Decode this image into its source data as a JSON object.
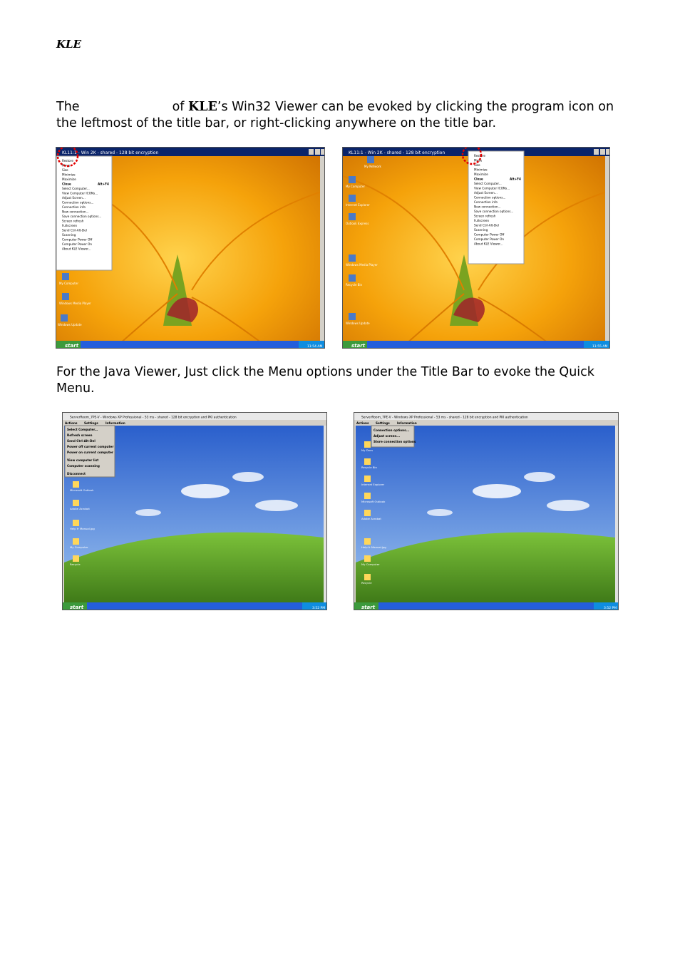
{
  "header": {
    "brand": "KLE"
  },
  "intro": {
    "part1": "The",
    "part2": "of",
    "brand": "KLE",
    "part3": "’s Win32 Viewer can be evoked by clicking the program icon on the leftmost of the title bar, or right-clicking anywhere on the title bar."
  },
  "java_note": "For the Java Viewer, Just click the Menu options under the Title Bar to evoke the Quick Menu.",
  "win32_left": {
    "title": "KL11:1 - Win 2K - shared - 128 bit encryption",
    "menu_items": [
      "Restore",
      "Move",
      "Size",
      "Minimize",
      "Maximize",
      "Close",
      "Alt+F4",
      "Select Computer...",
      "View Computer ICONs...",
      "Adjust Screen...",
      "Connection options...",
      "Connection info",
      "New connection...",
      "Save connection options...",
      "Screen refresh",
      "Fullscreen",
      "Send Ctrl-Alt-Del",
      "Scanning",
      "Computer Power Off",
      "Computer Power On",
      "About KLE Viewer..."
    ],
    "taskbar": {
      "start": "start",
      "clock": "11:54 AM"
    },
    "desktop_icons": [
      "My Computer",
      "Windows Media Player",
      "Windows Update"
    ]
  },
  "win32_right": {
    "title": "KL11:1 - Win 2K - shared - 128 bit encryption",
    "menu_items": [
      "Restore",
      "Move",
      "Size",
      "Minimize",
      "Maximize",
      "Close",
      "Alt+F4",
      "Select Computer...",
      "View Computer ICONs...",
      "Adjust Screen...",
      "Connection options...",
      "Connection info",
      "New connection...",
      "Save connection options...",
      "Screen refresh",
      "Fullscreen",
      "Send Ctrl-Alt-Del",
      "Scanning",
      "Computer Power Off",
      "Computer Power On",
      "About KLE Viewer..."
    ],
    "taskbar": {
      "start": "start",
      "clock": "11:55 AM"
    },
    "desktop_icons": [
      "My Computer",
      "My Network",
      "Internet Explorer",
      "Outlook Express",
      "Windows Media Player",
      "Recycle Bin",
      "Windows Update"
    ]
  },
  "java_left": {
    "title": "ServerRoom_7PE-V - Windows XP Professional - 53 ms - shared - 128 bit encryption and PKI authentication",
    "menubar": [
      "Actions",
      "Settings",
      "Information"
    ],
    "menu_items": [
      "Select Computer...",
      "Refresh screen",
      "Send Ctrl-Alt-Del",
      "Power off current computer",
      "Power on current computer",
      "View computer list",
      "Computer scanning",
      "Disconnect"
    ],
    "taskbar": {
      "start": "start",
      "clock": "3:52 PM"
    },
    "desktop_icons": [
      "Microsoft Outlook",
      "Adobe Acrobat",
      "Help fr Manual.jpg",
      "My Computer",
      "Recycle"
    ]
  },
  "java_right": {
    "title": "ServerRoom_7PE-V - Windows XP Professional - 53 ms - shared - 128 bit encryption and PKI authentication",
    "menubar": [
      "Actions",
      "Settings",
      "Information"
    ],
    "menu_items": [
      "Connection options...",
      "Adjust screen...",
      "Store connection options"
    ],
    "taskbar": {
      "start": "start",
      "clock": "3:52 PM"
    },
    "desktop_icons": [
      "My Docs",
      "Recycle Bin",
      "Internet Explorer",
      "Microsoft Outlook",
      "Adobe Acrobat",
      "Help fr Manual.jpg",
      "My Computer",
      "Recycle"
    ]
  },
  "colors": {
    "xp_blue": "#0a246a",
    "taskbar_blue": "#245edb",
    "start_green": "#3c9a3c",
    "flower_orange": "#f5a20a",
    "sky_blue": "#3a6fd8",
    "hill_green": "#5a9e2a",
    "marker_red": "#e00000"
  }
}
